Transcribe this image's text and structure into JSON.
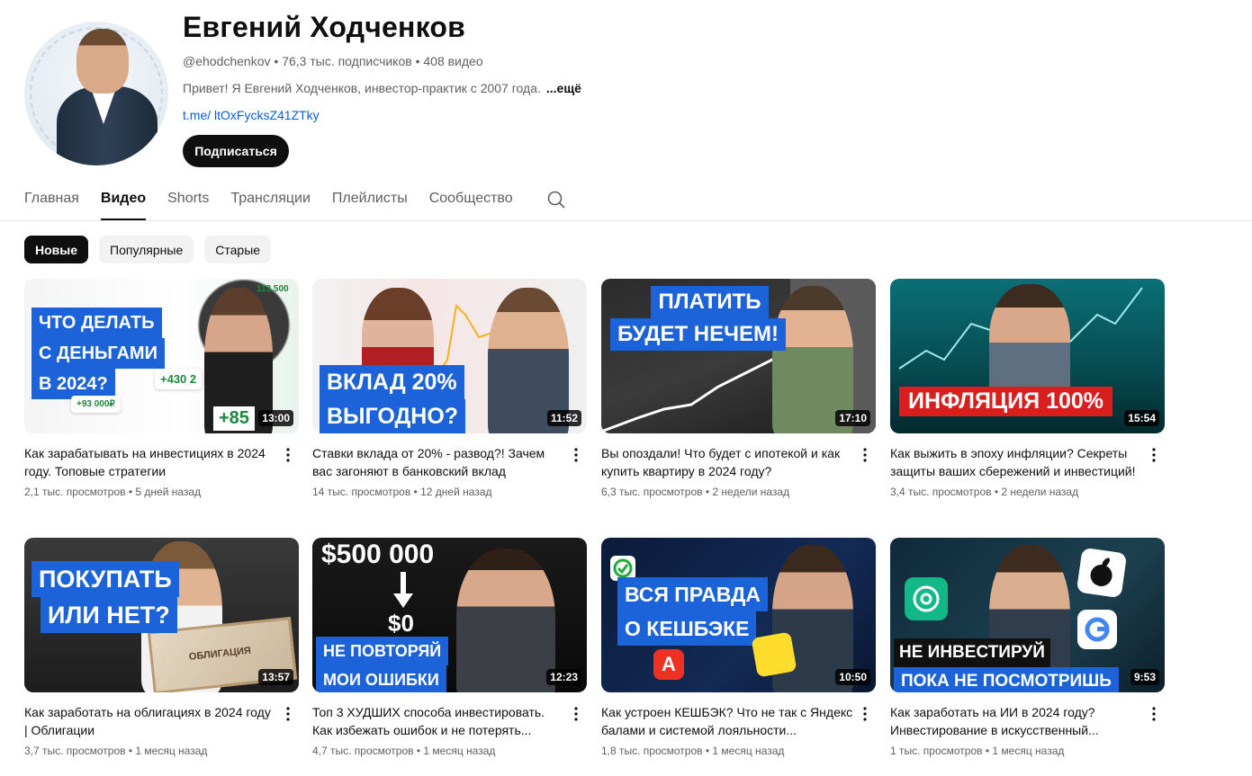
{
  "channel": {
    "name": "Евгений Ходченков",
    "handle": "@ehodchenkov",
    "subscribers": "76,3 тыс. подписчиков",
    "video_count": "408 видео",
    "description": "Привет! Я Евгений Ходченков, инвестор-практик с 2007 года.",
    "more_label": "...ещё",
    "link": "t.me/ ltOxFycksZ41ZTky",
    "subscribe_label": "Подписаться"
  },
  "tabs": [
    {
      "label": "Главная"
    },
    {
      "label": "Видео"
    },
    {
      "label": "Shorts"
    },
    {
      "label": "Трансляции"
    },
    {
      "label": "Плейлисты"
    },
    {
      "label": "Сообщество"
    }
  ],
  "active_tab": "Видео",
  "chips": [
    {
      "label": "Новые"
    },
    {
      "label": "Популярные"
    },
    {
      "label": "Старые"
    }
  ],
  "videos": [
    {
      "title": "Как зарабатывать на инвестициях в 2024 году. Топовые стратегии",
      "views": "2,1 тыс. просмотров",
      "age": "5 дней назад",
      "duration": "13:00",
      "thumb_text": [
        "ЧТО ДЕЛАТЬ",
        "С ДЕНЬГАМИ",
        "В 2024?"
      ],
      "thumb_extra": [
        "+430 2",
        "+93 000₽",
        "+85",
        "113 500"
      ]
    },
    {
      "title": "Ставки вклада от 20% - развод?! Зачем вас загоняют в банковский вклад",
      "views": "14 тыс. просмотров",
      "age": "12 дней назад",
      "duration": "11:52",
      "thumb_text": [
        "ВКЛАД 20%",
        "ВЫГОДНО?"
      ]
    },
    {
      "title": "Вы опоздали! Что будет с ипотекой и как купить квартиру в 2024 году?",
      "views": "6,3 тыс. просмотров",
      "age": "2 недели назад",
      "duration": "17:10",
      "thumb_text": [
        "ПЛАТИТЬ",
        "БУДЕТ НЕЧЕМ!"
      ]
    },
    {
      "title": "Как выжить в эпоху инфляции? Секреты защиты ваших сбережений и инвестиций!",
      "views": "3,4 тыс. просмотров",
      "age": "2 недели назад",
      "duration": "15:54",
      "thumb_text": [
        "ИНФЛЯЦИЯ 100%"
      ]
    },
    {
      "title": "Как заработать на облигациях в 2024 году | Облигации",
      "views": "3,7 тыс. просмотров",
      "age": "1 месяц назад",
      "duration": "13:57",
      "thumb_text": [
        "ПОКУПАТЬ",
        "ИЛИ НЕТ?"
      ],
      "thumb_extra": [
        "ОБЛИГАЦИЯ"
      ]
    },
    {
      "title": "Топ 3 ХУДШИХ способа инвестировать. Как избежать ошибок и не потерять...",
      "views": "4,7 тыс. просмотров",
      "age": "1 месяц назад",
      "duration": "12:23",
      "thumb_text": [
        "$500 000",
        "$0",
        "НЕ ПОВТОРЯЙ",
        "МОИ ОШИБКИ"
      ]
    },
    {
      "title": "Как устроен КЕШБЭК? Что не так с Яндекс балами и системой лояльности...",
      "views": "1,8 тыс. просмотров",
      "age": "1 месяц назад",
      "duration": "10:50",
      "thumb_text": [
        "ВСЯ ПРАВДА",
        "О КЕШБЭКЕ"
      ]
    },
    {
      "title": "Как заработать на ИИ в 2024 году? Инвестирование в искусственный...",
      "views": "1 тыс. просмотров",
      "age": "1 месяц назад",
      "duration": "9:53",
      "thumb_text": [
        "НЕ ИНВЕСТИРУЙ",
        "ПОКА НЕ ПОСМОТРИШЬ"
      ]
    }
  ],
  "colors": {
    "accent": "#0f0f0f",
    "link": "#065fd4",
    "thumb_blue": "#1c63d9",
    "thumb_red": "#d91e1e"
  }
}
